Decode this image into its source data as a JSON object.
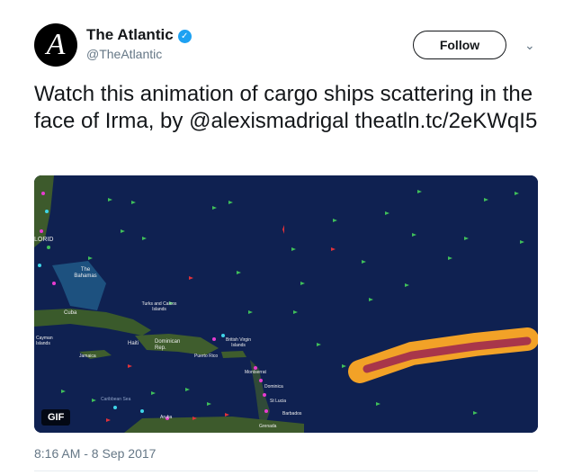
{
  "author": {
    "avatar_letter": "A",
    "name": "The Atlantic",
    "handle": "@TheAtlantic",
    "verified_mark": "✓"
  },
  "actions": {
    "follow_label": "Follow",
    "more_icon": "chevron-down"
  },
  "tweet": {
    "text_plain": "Watch this animation of cargo ships scattering in the face of Irma, by",
    "mention": "@alexismadrigal",
    "link": "theatln.tc/2eKWqI5"
  },
  "media": {
    "badge": "GIF",
    "map_labels": {
      "florida": "LORID",
      "bahamas": "The Bahamas",
      "cuba": "Cuba",
      "turks": "Turks and Caicos Islands",
      "cayman": "Cayman Islands",
      "haiti": "Haiti",
      "dominican": "Dominican Rep.",
      "jamaica": "Jamaica",
      "bvi": "British Virgin Islands",
      "puerto_rico": "Puerto Rico",
      "montserrat": "Montserrat",
      "dominica": "Dominica",
      "st_lucia": "St Lucia",
      "barbados": "Barbados",
      "grenada": "Grenada",
      "caribbean": "Caribbean Sea",
      "aruba": "Aruba"
    }
  },
  "timestamp": "8:16 AM - 8 Sep 2017",
  "colors": {
    "ocean": "#0d1d4a",
    "land": "#3d5a2c",
    "storm_outer": "#f2a227",
    "storm_inner": "#a8364a",
    "ship_green": "#3fbf5a",
    "ship_red": "#e0323a",
    "ship_pink": "#e73bd0",
    "ship_cyan": "#3fd5e8"
  }
}
